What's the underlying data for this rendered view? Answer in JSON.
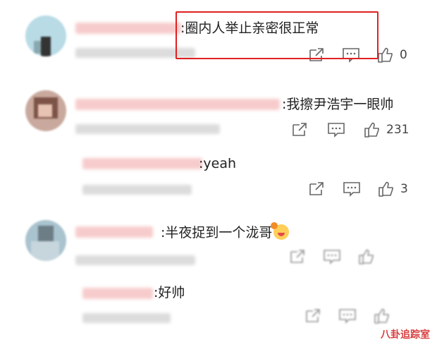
{
  "comments": [
    {
      "id": "c1",
      "text": ":圈内人举止亲密很正常",
      "likes": "0",
      "replies": []
    },
    {
      "id": "c2",
      "text": ":我擦尹浩宇一眼帅",
      "likes": "231",
      "replies": [
        {
          "id": "c2r1",
          "text": ":yeah",
          "likes": "3"
        }
      ]
    },
    {
      "id": "c3",
      "text": ":半夜捉到一个泷哥",
      "likes": "",
      "replies": [
        {
          "id": "c3r1",
          "text": ":好帅",
          "likes": ""
        }
      ]
    }
  ],
  "icons": {
    "share": "share-icon",
    "comment": "comment-icon",
    "like": "thumbs-up-icon"
  },
  "colors": {
    "highlight": "#e02020",
    "icon": "#666666",
    "watermark": "#d42a2a"
  },
  "watermark": "八卦追踪室"
}
